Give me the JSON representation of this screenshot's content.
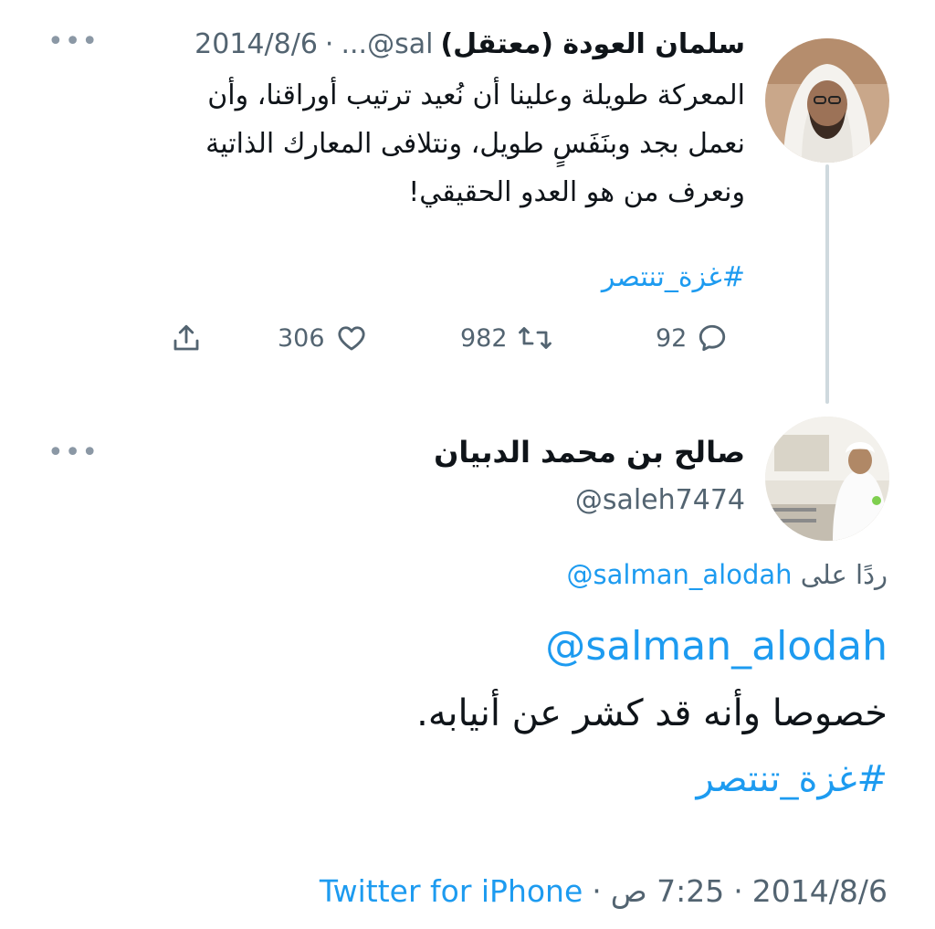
{
  "parent_tweet": {
    "name": "سلمان العودة (معتقل)",
    "handle": "...@sal",
    "separator": "·",
    "date": "2014/8/6",
    "text_lines": [
      "المعركة طويلة وعلينا أن نُعيد ترتيب أوراقنا، وأن",
      "نعمل بجد وبنَفَسٍ طويل، ونتلافى المعارك الذاتية",
      "ونعرف من هو العدو الحقيقي!"
    ],
    "hashtag": "#غزة_تنتصر",
    "replies": "92",
    "retweets": "982",
    "likes": "306",
    "more": "•••"
  },
  "reply_tweet": {
    "name": "صالح بن محمد الدبيان",
    "handle": "@saleh7474",
    "replying_prefix": "ردًا على",
    "replying_to": "@salman_alodah",
    "mention": "@salman_alodah",
    "text": "خصوصا وأنه قد كشر عن أنيابه.",
    "hashtag": "#غزة_تنتصر",
    "date": "2014/8/6",
    "time": "7:25 ص",
    "separator": "·",
    "source": "Twitter for iPhone",
    "more": "•••"
  },
  "icons": {
    "reply": "reply-icon",
    "retweet": "retweet-icon",
    "like": "heart-icon",
    "share": "share-icon"
  },
  "colors": {
    "link": "#1d9bf0",
    "secondary_text": "#536471",
    "thread_line": "#cfd9de"
  }
}
